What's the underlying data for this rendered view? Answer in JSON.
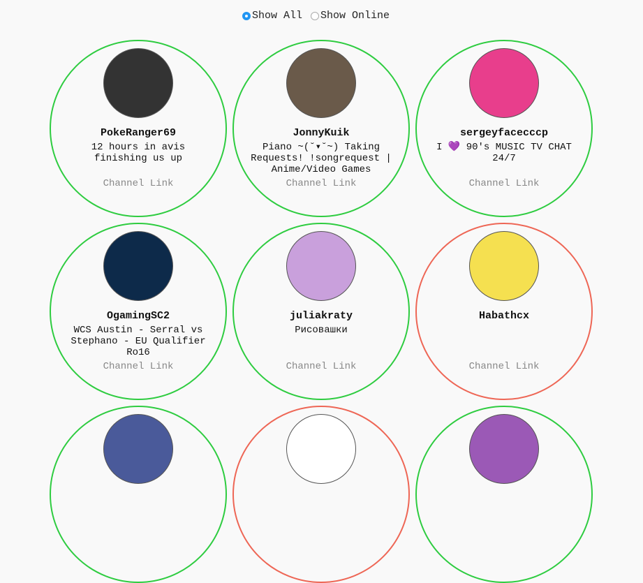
{
  "filters": {
    "all": "Show All",
    "online": "Show Online",
    "selected": "all"
  },
  "channels": [
    {
      "name": "PokeRanger69",
      "desc": "12 hours in avis finishing us up",
      "link": "Channel Link",
      "status": "online",
      "avatar_color": "#333"
    },
    {
      "name": "JonnyKuik",
      "desc": "Piano ~(˘▾˘~) Taking Requests! !songrequest | Anime/Video Games",
      "link": "Channel Link",
      "status": "online",
      "avatar_color": "#6a5a4a"
    },
    {
      "name": "sergeyfacecccp",
      "desc": "I 💜 90's MUSIC TV CHAT 24/7",
      "link": "Channel Link",
      "status": "online",
      "avatar_color": "#e83e8c"
    },
    {
      "name": "OgamingSC2",
      "desc": "WCS Austin - Serral vs Stephano - EU Qualifier Ro16",
      "link": "Channel Link",
      "status": "online",
      "avatar_color": "#0d2a4a"
    },
    {
      "name": "juliakraty",
      "desc": "Рисовашки",
      "link": "Channel Link",
      "status": "online",
      "avatar_color": "#c9a0dc"
    },
    {
      "name": "Habathcx",
      "desc": "",
      "link": "Channel Link",
      "status": "offline",
      "avatar_color": "#f5e050"
    },
    {
      "name": "",
      "desc": "",
      "link": "",
      "status": "online",
      "avatar_color": "#4a5a9a"
    },
    {
      "name": "",
      "desc": "",
      "link": "",
      "status": "offline",
      "avatar_color": "#ffffff"
    },
    {
      "name": "",
      "desc": "",
      "link": "",
      "status": "online",
      "avatar_color": "#9b59b6"
    }
  ]
}
